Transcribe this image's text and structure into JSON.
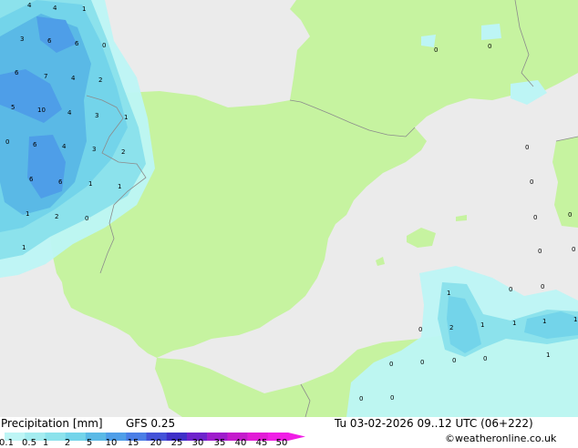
{
  "footer": {
    "product": "Precipitation [mm]",
    "model": "GFS 0.25",
    "valid": "Tu 03-02-2026 09..12 UTC (06+222)",
    "credit": "©weatheronline.co.uk"
  },
  "legend": {
    "levels": [
      "0.1",
      "0.5",
      "1",
      "2",
      "5",
      "10",
      "15",
      "20",
      "25",
      "30",
      "35",
      "40",
      "45",
      "50"
    ],
    "colors": [
      "#bdf5f5",
      "#a4ecf0",
      "#8ce2ec",
      "#73d4ea",
      "#5ab9e6",
      "#4e9ee8",
      "#4a7ee6",
      "#4352d8",
      "#3e2fc8",
      "#6d22cc",
      "#9e1ccc",
      "#c41bcc",
      "#e11bd6",
      "#f01ee6"
    ]
  },
  "colors": {
    "land": "#c6f3a0",
    "sea": "#ebebeb",
    "border": "#8c8c8c"
  },
  "map_labels": {
    "r1": "4",
    "r2": "4",
    "r3": "1",
    "r4": "3",
    "r5": "6",
    "r6": "6",
    "r7": "0",
    "r8": "6",
    "r9": "7",
    "r10": "4",
    "r11": "2",
    "r12": "5",
    "r13": "10",
    "r14": "4",
    "r15": "3",
    "r16": "1",
    "r17": "0",
    "r18": "6",
    "r19": "4",
    "r20": "3",
    "r21": "2",
    "r22": "6",
    "r23": "6",
    "r24": "1",
    "r25": "1",
    "r26": "1",
    "r27": "2",
    "r28": "0",
    "r29": "1",
    "r30": "0",
    "r31": "0",
    "r32": "0",
    "r33": "0",
    "r34": "0",
    "r35": "0",
    "r36": "0",
    "r37": "0",
    "r38": "0",
    "r39": "1",
    "r40": "0",
    "r41": "2",
    "r42": "1",
    "r43": "1",
    "r44": "1",
    "r45": "1",
    "r46": "0",
    "r47": "0",
    "r48": "0",
    "r49": "0",
    "r50": "0",
    "r51": "1",
    "r52": "0",
    "r53": "0"
  }
}
